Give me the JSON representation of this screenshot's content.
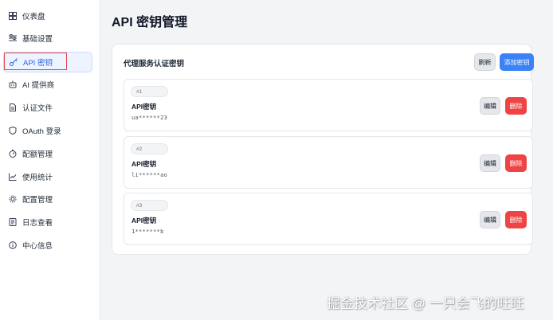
{
  "sidebar": {
    "items": [
      {
        "label": "仪表盘",
        "icon": "dashboard-icon"
      },
      {
        "label": "基础设置",
        "icon": "sliders-icon"
      },
      {
        "label": "API 密钥",
        "icon": "key-icon",
        "active": true
      },
      {
        "label": "AI 提供商",
        "icon": "robot-icon"
      },
      {
        "label": "认证文件",
        "icon": "file-icon"
      },
      {
        "label": "OAuth 登录",
        "icon": "shield-icon"
      },
      {
        "label": "配额管理",
        "icon": "gauge-icon"
      },
      {
        "label": "使用统计",
        "icon": "chart-icon"
      },
      {
        "label": "配置管理",
        "icon": "gear-icon"
      },
      {
        "label": "日志查看",
        "icon": "log-icon"
      },
      {
        "label": "中心信息",
        "icon": "info-icon"
      }
    ]
  },
  "main": {
    "title": "API 密钥管理",
    "card": {
      "title": "代理服务认证密钥",
      "refresh_label": "刷新",
      "add_label": "添加密钥",
      "keys": [
        {
          "index": "#1",
          "name": "API密钥",
          "value": "ua******23",
          "edit_label": "编辑",
          "delete_label": "删除"
        },
        {
          "index": "#2",
          "name": "API密钥",
          "value": "li******ao",
          "edit_label": "编辑",
          "delete_label": "删除"
        },
        {
          "index": "#3",
          "name": "API密钥",
          "value": "1*******b",
          "edit_label": "编辑",
          "delete_label": "删除"
        }
      ]
    }
  },
  "watermark": "掘金技术社区 @ 一只会飞的旺旺",
  "colors": {
    "accent": "#3b82f6",
    "danger": "#ef4444",
    "active_bg": "#eef4ff",
    "highlight": "#e5484d"
  }
}
